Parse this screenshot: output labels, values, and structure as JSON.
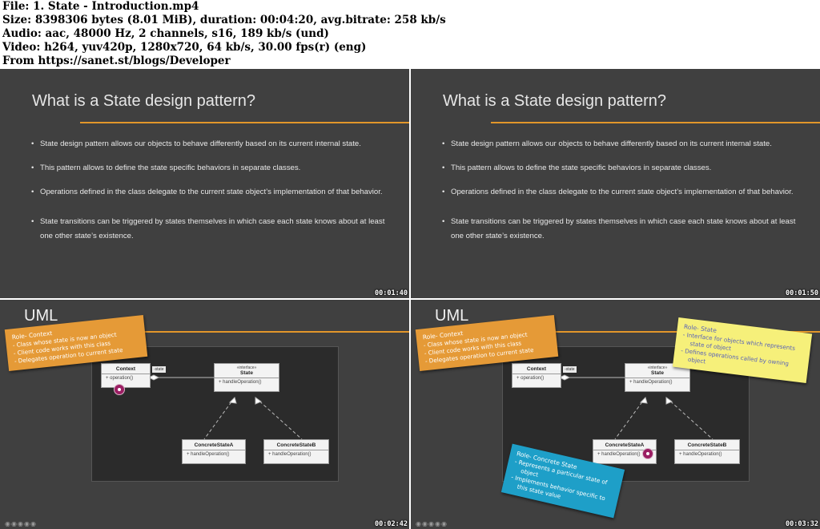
{
  "header": {
    "line1": "File: 1. State - Introduction.mp4",
    "line2": "Size: 8398306 bytes (8.01 MiB), duration: 00:04:20, avg.bitrate: 258 kb/s",
    "line3": "Audio: aac, 48000 Hz, 2 channels, s16, 189 kb/s (und)",
    "line4": "Video: h264, yuv420p, 1280x720, 64 kb/s, 30.00 fps(r) (eng)",
    "line5": "From https://sanet.st/blogs/Developer"
  },
  "slide": {
    "title": "What is a State design pattern?",
    "bullets": [
      "State design pattern allows our objects to behave differently based on its current internal state.",
      "This pattern allows to define the state specific behaviors in separate classes.",
      "Operations defined in the class delegate to the current state object’s implementation of that behavior.",
      "State transitions can be triggered by states themselves in which case each state knows about at least",
      "one other state’s existence."
    ]
  },
  "uml": {
    "title": "UML",
    "context": {
      "name": "Context",
      "op": "+ operation()"
    },
    "assoc": "-state",
    "state": {
      "stereotype": "«interface»",
      "name": "State",
      "op": "+ handleOperation()"
    },
    "concrete_a": {
      "name": "ConcreteStateA",
      "op": "+ handleOperation()"
    },
    "concrete_b": {
      "name": "ConcreteStateB",
      "op": "+ handleOperation()"
    }
  },
  "notes": {
    "context": {
      "title": "Role- Context",
      "items": [
        "- Class whose state is now an object",
        "- Client code works with this class",
        "- Delegates operation to current state"
      ]
    },
    "state": {
      "title": "Role- State",
      "items": [
        "- Interface for objects which represents state of object",
        "- Defines operations called by owning object"
      ]
    },
    "concrete": {
      "title": "Role- Concrete State",
      "items": [
        "- Represents a particular state of object",
        "- Implements behavior specific to this state value"
      ]
    }
  },
  "timestamps": [
    "00:01:40",
    "00:01:50",
    "00:02:42",
    "00:03:32"
  ],
  "colors": {
    "accent": "#e2962a",
    "slide_bg": "#404040",
    "note_context": "#e59a37",
    "note_state": "#f6f07a",
    "note_concrete": "#1e9fc8"
  }
}
